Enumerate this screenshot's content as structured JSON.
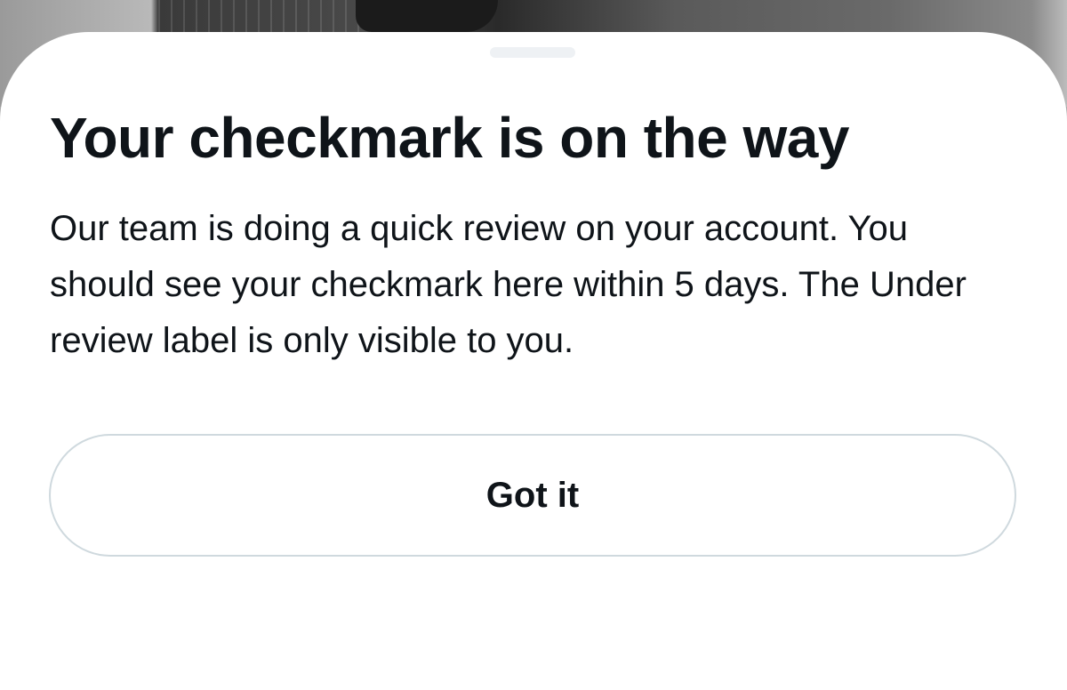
{
  "sheet": {
    "title": "Your checkmark is on the way",
    "body": "Our team is doing a quick review on your account. You should see your checkmark here within 5 days. The Under review label is only visible to you.",
    "button_label": "Got it"
  },
  "colors": {
    "text": "#0f1419",
    "sheet_background": "#ffffff",
    "button_border": "#cfd9de",
    "grabber": "#eef1f4"
  }
}
